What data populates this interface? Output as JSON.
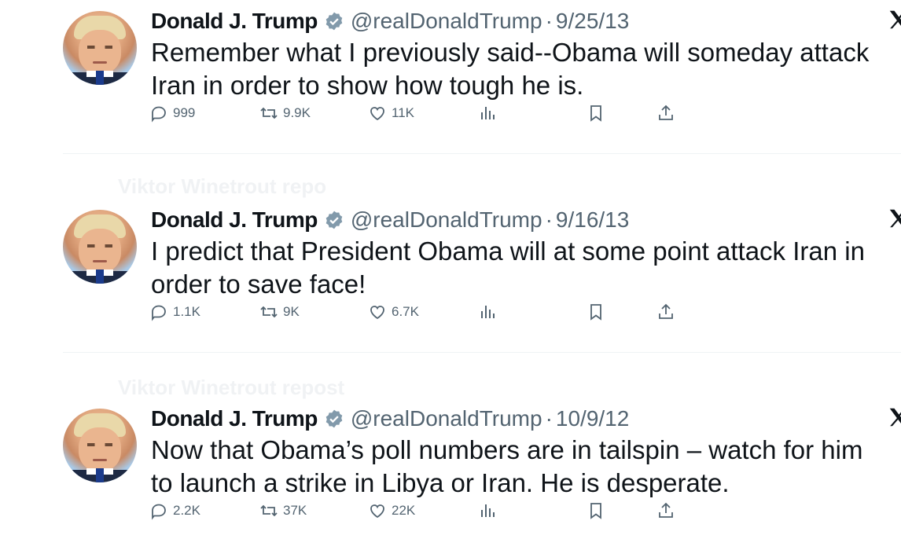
{
  "tweets": [
    {
      "name": "Donald J. Trump",
      "handle": "@realDonaldTrump",
      "separator": "·",
      "date": "9/25/13",
      "text": "Remember what I previously said--Obama will someday attack\nIran in order to show how tough he is.",
      "replies": "999",
      "reposts": "9.9K",
      "likes": "11K"
    },
    {
      "name": "Donald J. Trump",
      "handle": "@realDonaldTrump",
      "separator": "·",
      "date": "9/16/13",
      "text": "I predict that President Obama will at some point attack Iran in\norder to save face!",
      "replies": "1.1K",
      "reposts": "9K",
      "likes": "6.7K"
    },
    {
      "name": "Donald J. Trump",
      "handle": "@realDonaldTrump",
      "separator": "·",
      "date": "10/9/12",
      "text": "Now that Obama’s poll numbers are in tailspin – watch for him\nto launch a strike in Libya or Iran.  He is desperate.",
      "replies": "2.2K",
      "reposts": "37K",
      "likes": "22K"
    }
  ],
  "faded_repost_labels": [
    "Viktor Winetrout repo",
    "Viktor Winetrout repost"
  ],
  "colors": {
    "text": "#0f1419",
    "secondary": "#536471",
    "verified": "#829aab",
    "divider": "#eff3f4"
  },
  "icons": [
    "verified-badge-icon",
    "x-logo-icon",
    "reply-icon",
    "repost-icon",
    "like-icon",
    "views-icon",
    "bookmark-icon",
    "share-icon"
  ]
}
